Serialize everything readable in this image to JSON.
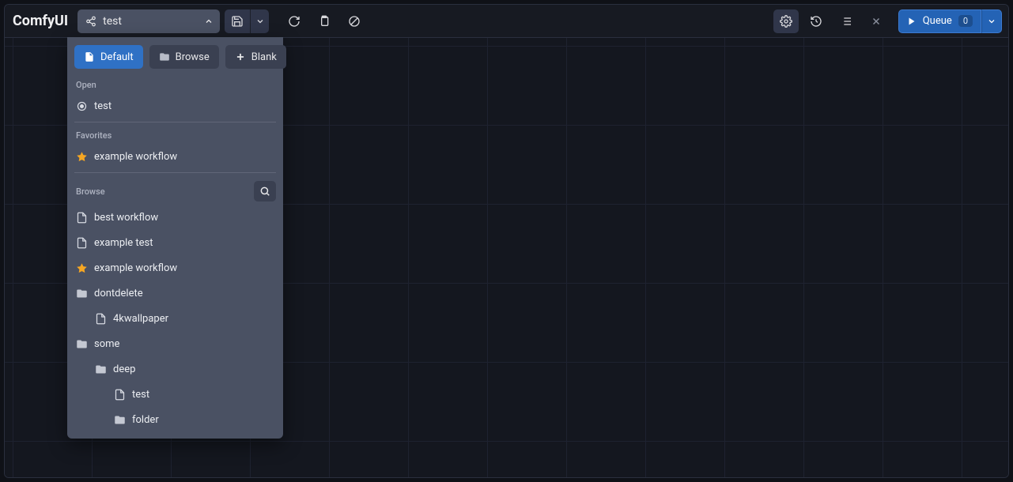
{
  "app": {
    "title": "ComfyUI"
  },
  "toolbar": {
    "workflow_name": "test",
    "queue_label": "Queue",
    "queue_count": "0"
  },
  "dropdown": {
    "tabs": {
      "default": "Default",
      "browse": "Browse",
      "blank": "Blank"
    },
    "sections": {
      "open": "Open",
      "favorites": "Favorites",
      "browse": "Browse"
    },
    "open_items": [
      {
        "label": "test",
        "icon": "target"
      }
    ],
    "favorite_items": [
      {
        "label": "example workflow",
        "icon": "star"
      }
    ],
    "browse_items": [
      {
        "label": "best workflow",
        "icon": "file",
        "indent": 0
      },
      {
        "label": "example test",
        "icon": "file",
        "indent": 0
      },
      {
        "label": "example workflow",
        "icon": "star",
        "indent": 0
      },
      {
        "label": "dontdelete",
        "icon": "folder",
        "indent": 0
      },
      {
        "label": "4kwallpaper",
        "icon": "file",
        "indent": 1
      },
      {
        "label": "some",
        "icon": "folder",
        "indent": 0
      },
      {
        "label": "deep",
        "icon": "folder",
        "indent": 1
      },
      {
        "label": "test",
        "icon": "file",
        "indent": 2
      },
      {
        "label": "folder",
        "icon": "folder",
        "indent": 2
      }
    ]
  }
}
